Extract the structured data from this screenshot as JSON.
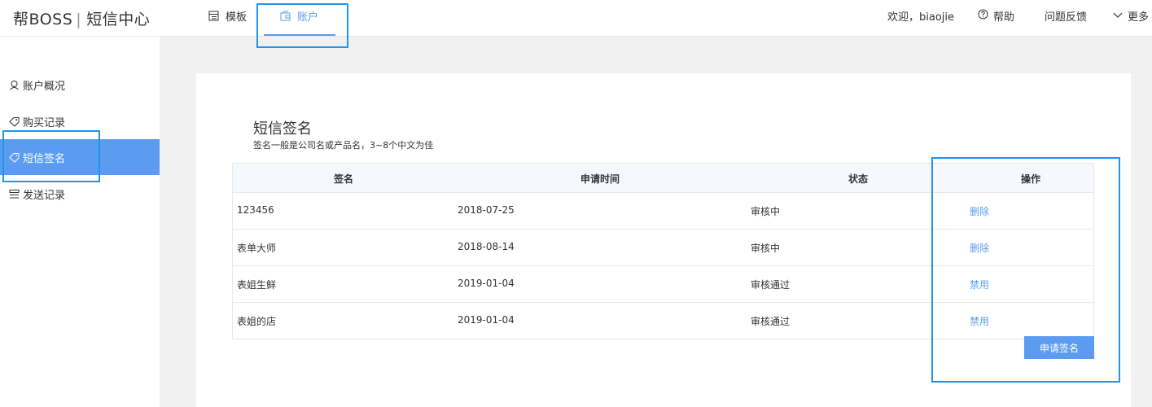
{
  "header": {
    "brand": "帮BOSS",
    "brand_separator": "|",
    "brand_section": "短信中心",
    "nav": [
      {
        "label": "模板",
        "icon": "template-icon"
      },
      {
        "label": "账户",
        "icon": "account-icon",
        "active": true
      }
    ],
    "welcome": "欢迎，biaojie",
    "help": "帮助",
    "feedback": "问题反馈",
    "more": "更多"
  },
  "sidebar": {
    "items": [
      {
        "label": "账户概况",
        "icon": "account-overview-icon"
      },
      {
        "label": "购买记录",
        "icon": "tag-icon"
      },
      {
        "label": "短信签名",
        "icon": "tag-icon",
        "active": true
      },
      {
        "label": "发送记录",
        "icon": "list-icon"
      }
    ]
  },
  "main": {
    "title": "短信签名",
    "subtitle": "签名一般是公司名或产品名，3~8个中文为佳",
    "table": {
      "headers": [
        "签名",
        "申请时间",
        "状态",
        "操作"
      ],
      "rows": [
        {
          "signature": "123456",
          "date": "2018-07-25",
          "status": "审核中",
          "action": "删除"
        },
        {
          "signature": "表单大师",
          "date": "2018-08-14",
          "status": "审核中",
          "action": "删除"
        },
        {
          "signature": "表姐生鲜",
          "date": "2019-01-04",
          "status": "审核通过",
          "action": "禁用"
        },
        {
          "signature": "表姐的店",
          "date": "2019-01-04",
          "status": "审核通过",
          "action": "禁用"
        }
      ]
    },
    "apply_button": "申请签名"
  },
  "colors": {
    "accent": "#5b9cf0",
    "highlight_box": "#1e96f0"
  }
}
